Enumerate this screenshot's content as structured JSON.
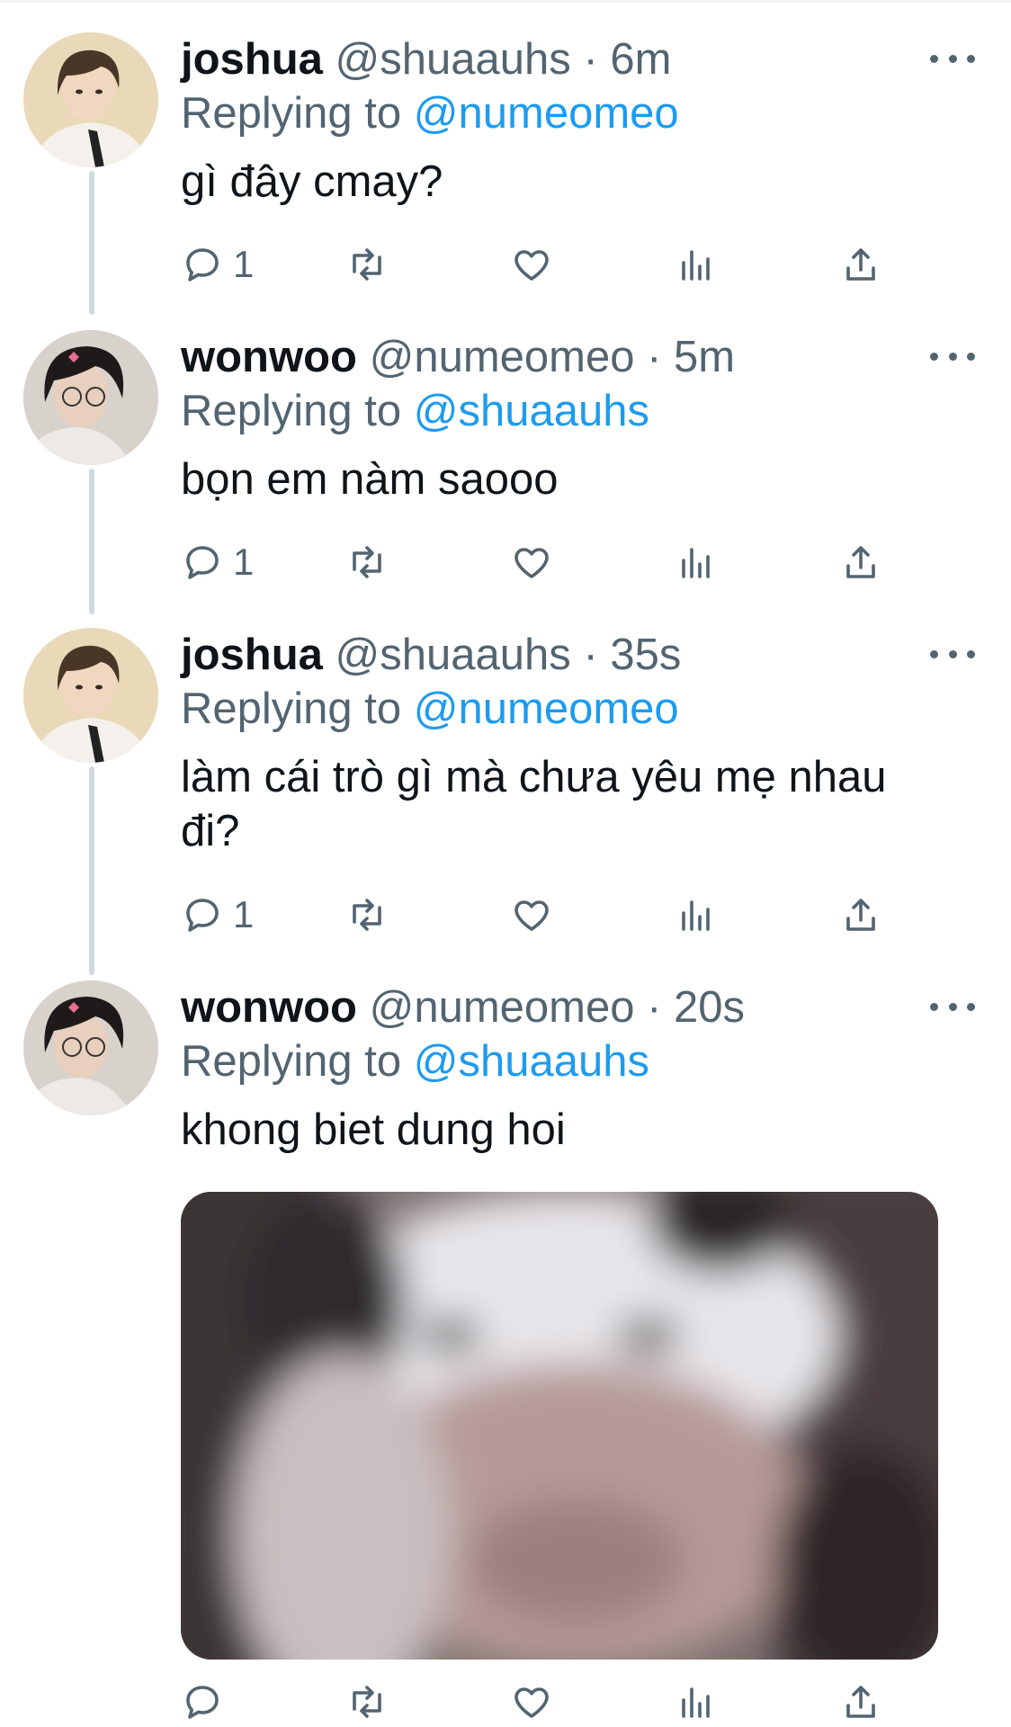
{
  "tweets": [
    {
      "name": "joshua",
      "handle": "@shuaauhs",
      "time": "6m",
      "replying_label": "Replying to",
      "replying_to": "@numeomeo",
      "text": "gì đây cmay?",
      "reply_count": "1",
      "avatar": "joshua-avatar"
    },
    {
      "name": "wonwoo",
      "handle": "@numeomeo",
      "time": "5m",
      "replying_label": "Replying to",
      "replying_to": "@shuaauhs",
      "text": "bọn em nàm saooo",
      "reply_count": "1",
      "avatar": "wonwoo-avatar"
    },
    {
      "name": "joshua",
      "handle": "@shuaauhs",
      "time": "35s",
      "replying_label": "Replying to",
      "replying_to": "@numeomeo",
      "text": "làm cái trò gì mà chưa yêu mẹ nhau\nđi?",
      "reply_count": "1",
      "avatar": "joshua-avatar"
    },
    {
      "name": "wonwoo",
      "handle": "@numeomeo",
      "time": "20s",
      "replying_label": "Replying to",
      "replying_to": "@shuaauhs",
      "text": "khong biet dung hoi",
      "reply_count": "",
      "avatar": "wonwoo-avatar",
      "has_media": true
    }
  ],
  "separator": "·",
  "icons": [
    "reply-icon",
    "retweet-icon",
    "like-icon",
    "views-icon",
    "share-icon",
    "more-icon"
  ],
  "colors": {
    "text": "#0f1419",
    "secondary": "#536471",
    "accent": "#1d9bf0",
    "thread_line": "#cfd9de"
  }
}
